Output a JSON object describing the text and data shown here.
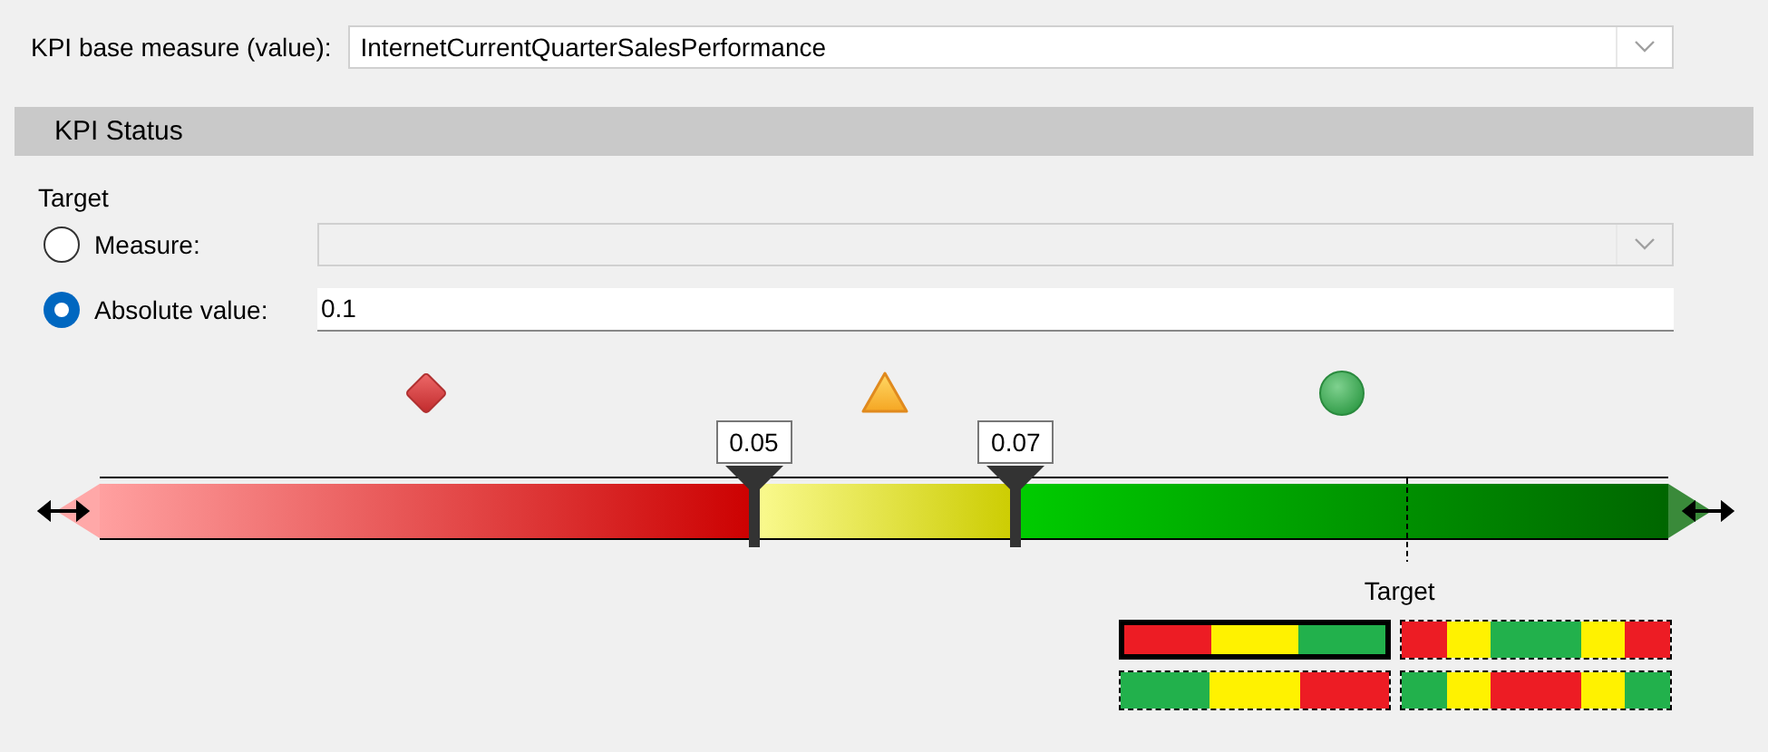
{
  "base_measure": {
    "label": "KPI base measure (value):",
    "value": "InternetCurrentQuarterSalesPerformance"
  },
  "section": {
    "title": "KPI Status"
  },
  "target": {
    "label": "Target",
    "options": [
      {
        "label": "Measure:",
        "selected": false,
        "kind": "combo"
      },
      {
        "label": "Absolute value:",
        "selected": true,
        "kind": "text",
        "value": "0.1"
      }
    ]
  },
  "status_icons": [
    {
      "kind": "diamond"
    },
    {
      "kind": "triangle"
    },
    {
      "kind": "circle"
    }
  ],
  "thresholds": [
    {
      "value": "0.05",
      "level": 0.417
    },
    {
      "value": "0.07",
      "level": 0.584
    }
  ],
  "target_marker": {
    "label": "Target",
    "level": 0.834
  },
  "patterns": [
    {
      "selected": true,
      "segments": [
        {
          "color": "#ed1c24"
        },
        {
          "color": "#fff200"
        },
        {
          "color": "#22b14c"
        }
      ]
    },
    {
      "selected": false,
      "segments": [
        {
          "color": "#ed1c24"
        },
        {
          "color": "#fff200"
        },
        {
          "color": "#22b14c"
        },
        {
          "color": "#22b14c"
        },
        {
          "color": "#fff200"
        },
        {
          "color": "#ed1c24"
        }
      ]
    },
    {
      "selected": false,
      "segments": [
        {
          "color": "#22b14c"
        },
        {
          "color": "#fff200"
        },
        {
          "color": "#ed1c24"
        }
      ]
    },
    {
      "selected": false,
      "segments": [
        {
          "color": "#22b14c"
        },
        {
          "color": "#fff200"
        },
        {
          "color": "#ed1c24"
        },
        {
          "color": "#ed1c24"
        },
        {
          "color": "#fff200"
        },
        {
          "color": "#22b14c"
        }
      ]
    }
  ]
}
